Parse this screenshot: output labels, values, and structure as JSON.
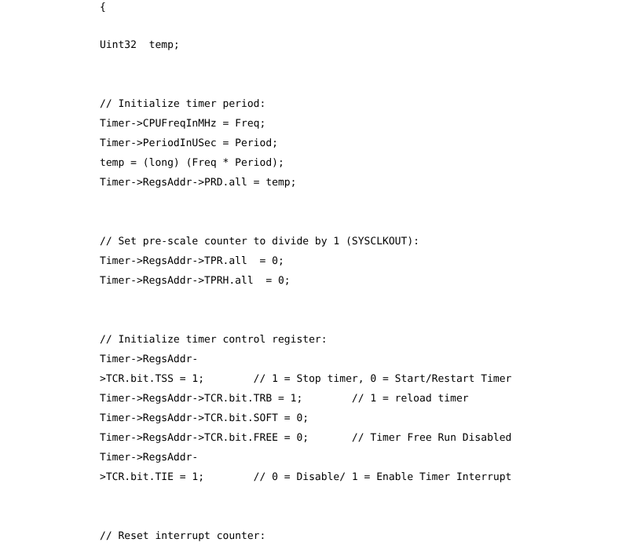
{
  "document": {
    "type": "source-code-listing",
    "language": "C",
    "background_color": "#ffffff",
    "text_color": "#000000"
  },
  "code": {
    "lines": [
      "{",
      "",
      "Uint32  temp;",
      "",
      "",
      "// Initialize timer period:",
      "Timer->CPUFreqInMHz = Freq;",
      "Timer->PeriodInUSec = Period;",
      "temp = (long) (Freq * Period);",
      "Timer->RegsAddr->PRD.all = temp;",
      "",
      "",
      "// Set pre-scale counter to divide by 1 (SYSCLKOUT):",
      "Timer->RegsAddr->TPR.all  = 0;",
      "Timer->RegsAddr->TPRH.all  = 0;",
      "",
      "",
      "// Initialize timer control register:",
      "Timer->RegsAddr-",
      ">TCR.bit.TSS = 1;        // 1 = Stop timer, 0 = Start/Restart Timer",
      "Timer->RegsAddr->TCR.bit.TRB = 1;        // 1 = reload timer",
      "Timer->RegsAddr->TCR.bit.SOFT = 0;",
      "Timer->RegsAddr->TCR.bit.FREE = 0;       // Timer Free Run Disabled",
      "Timer->RegsAddr-",
      ">TCR.bit.TIE = 1;        // 0 = Disable/ 1 = Enable Timer Interrupt",
      "",
      "",
      "// Reset interrupt counter:"
    ]
  }
}
